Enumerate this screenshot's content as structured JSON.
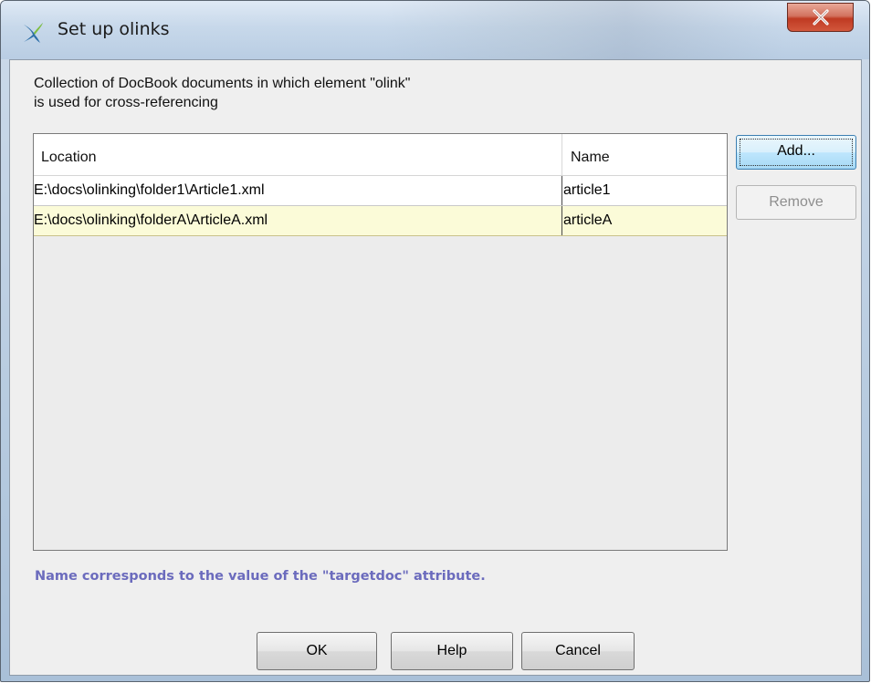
{
  "window": {
    "title": "Set up olinks",
    "close_label": "X"
  },
  "dialog": {
    "description": "Collection of DocBook documents in which element \"olink\"\nis used for cross-referencing",
    "note": "Name corresponds to the value of the \"targetdoc\" attribute."
  },
  "table": {
    "columns": [
      "Location",
      "Name"
    ],
    "rows": [
      {
        "location": "E:\\docs\\olinking\\folder1\\Article1.xml",
        "name": "article1"
      },
      {
        "location": "E:\\docs\\olinking\\folderA\\ArticleA.xml",
        "name": "articleA"
      }
    ],
    "selected_row": 1
  },
  "side_buttons": {
    "add": "Add...",
    "remove": "Remove"
  },
  "footer_buttons": {
    "ok": "OK",
    "help": "Help",
    "cancel": "Cancel"
  },
  "colors": {
    "selected_row": "#fbfbd8",
    "note_text": "#6b6bbd",
    "close_button": "#c9452c"
  },
  "icons": {
    "app": "oxygen-app-icon",
    "close": "close-icon"
  }
}
